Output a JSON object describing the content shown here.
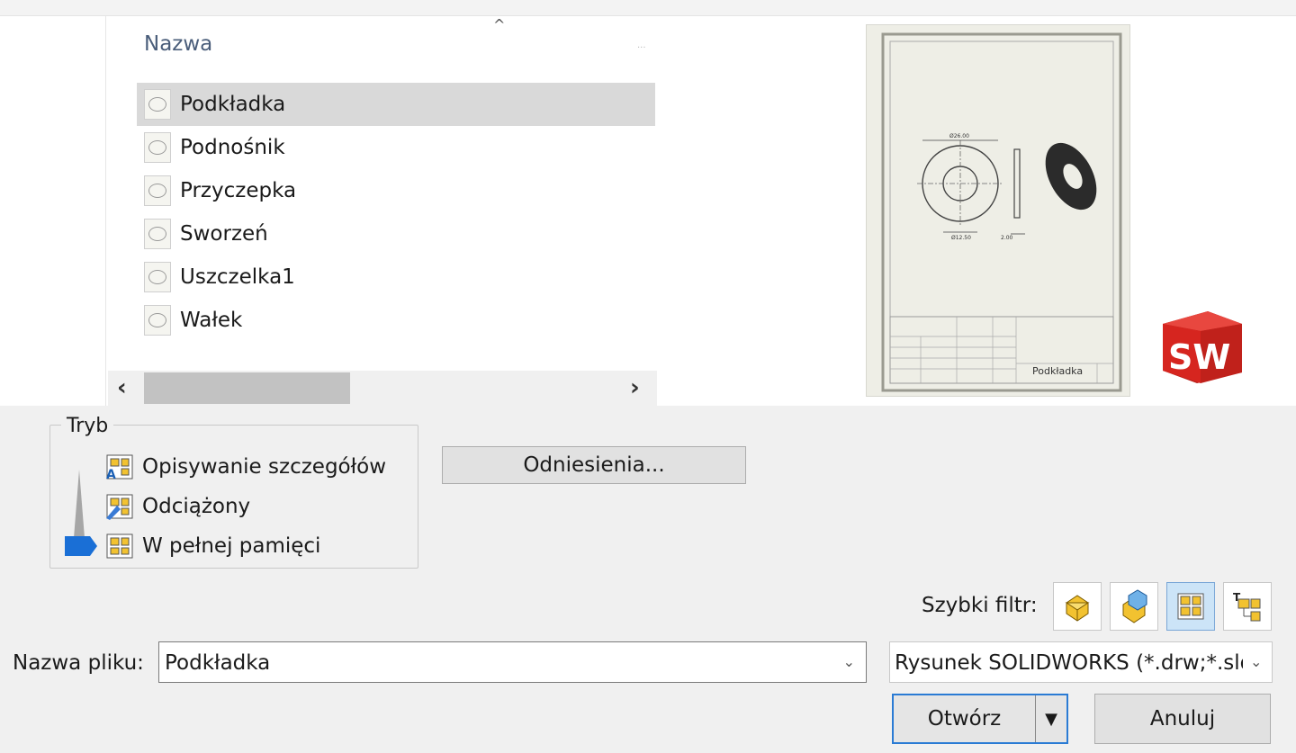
{
  "file_list": {
    "column_header": "Nazwa",
    "items": [
      {
        "name": "Podkładka",
        "selected": true
      },
      {
        "name": "Podnośnik",
        "selected": false
      },
      {
        "name": "Przyczepka",
        "selected": false
      },
      {
        "name": "Sworzeń",
        "selected": false
      },
      {
        "name": "Uszczelka1",
        "selected": false
      },
      {
        "name": "Wałek",
        "selected": false
      }
    ]
  },
  "preview": {
    "title_block_name": "Podkładka",
    "dim_outer": "Ø26.00",
    "dim_inner": "Ø12.50",
    "dim_thickness": "2.00",
    "logo_text": "SW"
  },
  "mode": {
    "group_label": "Tryb",
    "options": [
      {
        "label": "Opisywanie szczegółów"
      },
      {
        "label": "Odciążony"
      },
      {
        "label": "W pełnej pamięci",
        "selected": true
      }
    ]
  },
  "references_button": "Odniesienia...",
  "quick_filter": {
    "label": "Szybki filtr:",
    "buttons": [
      {
        "icon": "part-filter-icon",
        "active": false
      },
      {
        "icon": "assembly-filter-icon",
        "active": false
      },
      {
        "icon": "drawing-filter-icon",
        "active": true
      },
      {
        "icon": "top-level-assembly-filter-icon",
        "active": false
      }
    ]
  },
  "file_name": {
    "label": "Nazwa pliku:",
    "value": "Podkładka"
  },
  "file_type": {
    "value": "Rysunek SOLIDWORKS (*.drw;*.slddrw)"
  },
  "buttons": {
    "open": "Otwórz",
    "cancel": "Anuluj"
  },
  "colors": {
    "selection": "#d9d9d9",
    "accent_blue": "#2a7bd4",
    "logo_red": "#d6251f"
  }
}
